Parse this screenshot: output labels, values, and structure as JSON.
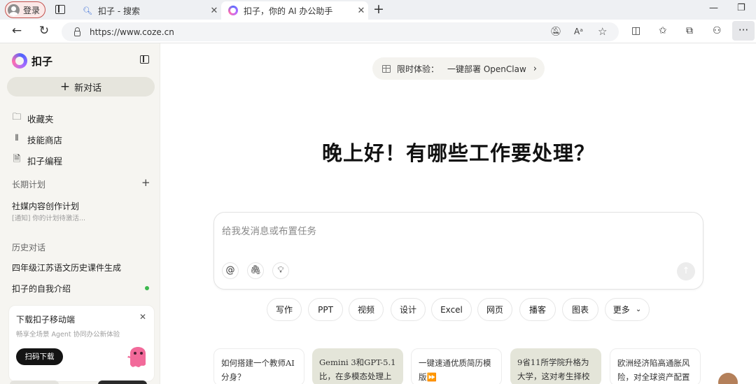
{
  "browser": {
    "profile_label": "登录",
    "tabs": [
      {
        "title": "扣子 - 搜索",
        "favicon": "search-icon",
        "active": false
      },
      {
        "title": "扣子，你的 AI 办公助手",
        "favicon": "coze-logo",
        "active": true
      }
    ],
    "url": "https://www.coze.cn"
  },
  "sidebar": {
    "brand": "扣子",
    "new_chat": "新对话",
    "nav": [
      {
        "label": "收藏夹",
        "icon": "folder-icon"
      },
      {
        "label": "技能商店",
        "icon": "books-icon"
      },
      {
        "label": "扣子编程",
        "icon": "code-file-icon"
      }
    ],
    "long_term_heading": "长期计划",
    "plan": {
      "title": "社媒内容创作计划",
      "subtitle": "[通知] 你的计划待激活..."
    },
    "history_heading": "历史对话",
    "history": [
      {
        "title": "四年级江苏语文历史课件生成"
      },
      {
        "title": "扣子的自我介绍"
      }
    ],
    "download_card": {
      "title": "下载扣子移动端",
      "subtitle": "畅享全场景 Agent 协同办公新体验",
      "button": "扫码下载"
    }
  },
  "main": {
    "promo": {
      "label": "限时体验：",
      "text": "一键部署 OpenClaw"
    },
    "greeting": "晚上好！有哪些工作要处理？",
    "input": {
      "placeholder": "给我发消息或布置任务"
    },
    "chips": [
      "写作",
      "PPT",
      "视频",
      "设计",
      "Excel",
      "网页",
      "播客",
      "图表",
      "更多"
    ],
    "suggestions": [
      {
        "text": "如何搭建一个教师AI分身？",
        "style": "plain"
      },
      {
        "text": "Gemini 3和GPT-5.1比，在多模态处理上",
        "style": "tinted"
      },
      {
        "text": "一键速通优质简历模版⏩",
        "style": "plain"
      },
      {
        "text": "9省11所学院升格为大学，这对考生择校",
        "style": "tinted"
      },
      {
        "text": "欧洲经济陷高通胀风险，对全球资产配置",
        "style": "plain"
      }
    ]
  },
  "colors": {
    "sidebar_bg": "#f6f5f1",
    "new_chat_bg": "#e6e5dd",
    "card_tint": "#e4e5d9",
    "profile_border": "#c4524e",
    "online_dot": "#3cb84e"
  }
}
